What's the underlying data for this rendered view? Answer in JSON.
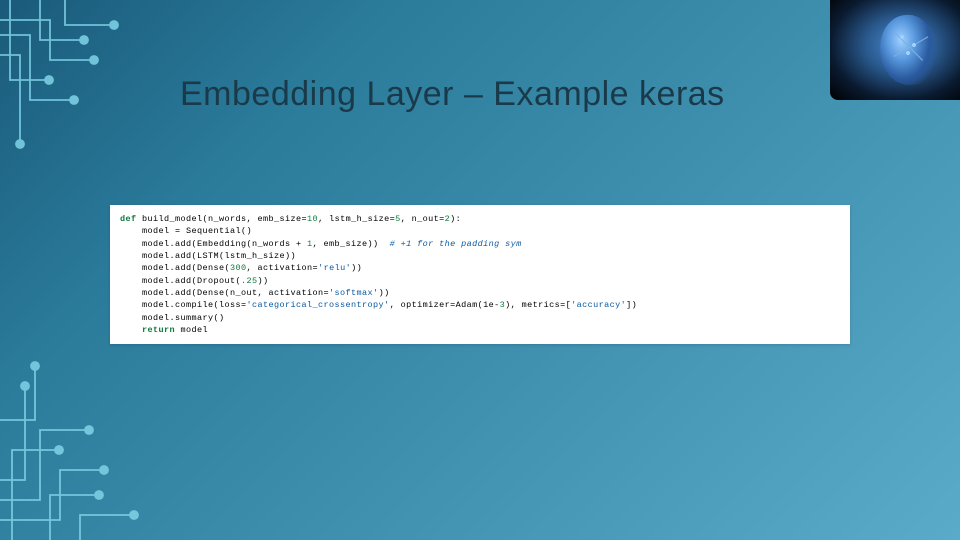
{
  "title": "Embedding Layer – Example keras",
  "code": {
    "l1a": "def",
    "l1b": " build_model(n_words, emb_size=",
    "l1c": "10",
    "l1d": ", lstm_h_size=",
    "l1e": "5",
    "l1f": ", n_out=",
    "l1g": "2",
    "l1h": "):",
    "l2": "    model = Sequential()",
    "l3a": "    model.add(Embedding(n_words + ",
    "l3b": "1",
    "l3c": ", emb_size))  ",
    "l3d": "# +1 for the padding sym",
    "l4": "    model.add(LSTM(lstm_h_size))",
    "l5a": "    model.add(Dense(",
    "l5b": "300",
    "l5c": ", activation=",
    "l5d": "'relu'",
    "l5e": "))",
    "l6a": "    model.add(Dropout(",
    "l6b": ".25",
    "l6c": "))",
    "l7a": "    model.add(Dense(n_out, activation=",
    "l7b": "'softmax'",
    "l7c": "))",
    "l8a": "    model.compile(loss=",
    "l8b": "'categorical_crossentropy'",
    "l8c": ", optimizer=Adam(1e-",
    "l8d": "3",
    "l8e": "), metrics=[",
    "l8f": "'accuracy'",
    "l8g": "])",
    "l9": "    model.summary()",
    "l10a": "    ",
    "l10b": "return",
    "l10c": " model"
  }
}
